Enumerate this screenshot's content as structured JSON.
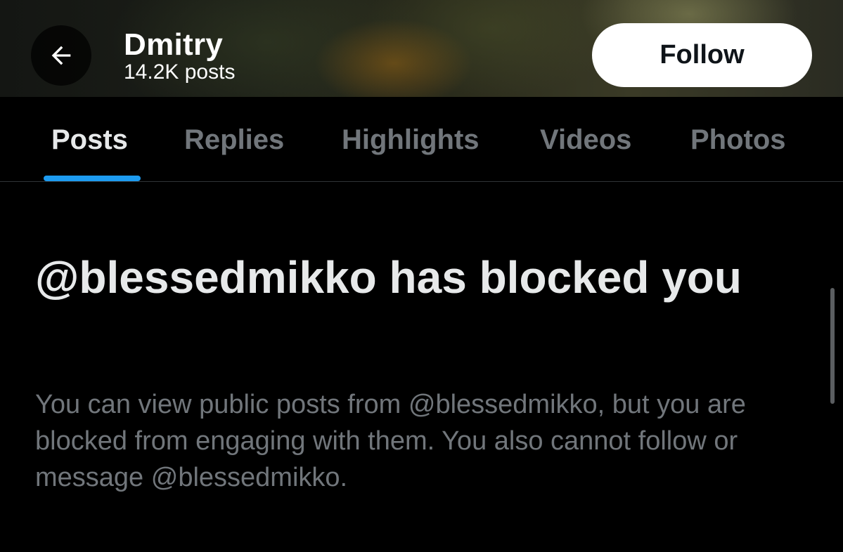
{
  "header": {
    "back_icon": "arrow-left-icon",
    "profile_name": "Dmitry",
    "post_count": "14.2K posts",
    "follow_label": "Follow"
  },
  "tabs": [
    {
      "label": "Posts",
      "active": true
    },
    {
      "label": "Replies",
      "active": false
    },
    {
      "label": "Highlights",
      "active": false
    },
    {
      "label": "Videos",
      "active": false
    },
    {
      "label": "Photos",
      "active": false
    }
  ],
  "blocked": {
    "title": "@blessedmikko has blocked you",
    "body": "You can view public posts from @blessedmikko, but you are blocked from engaging with them. You also cannot follow or message @blessedmikko."
  },
  "colors": {
    "accent": "#1d9bf0",
    "background": "#000000",
    "primary_text": "#e7e9ea",
    "secondary_text": "#71767b"
  }
}
